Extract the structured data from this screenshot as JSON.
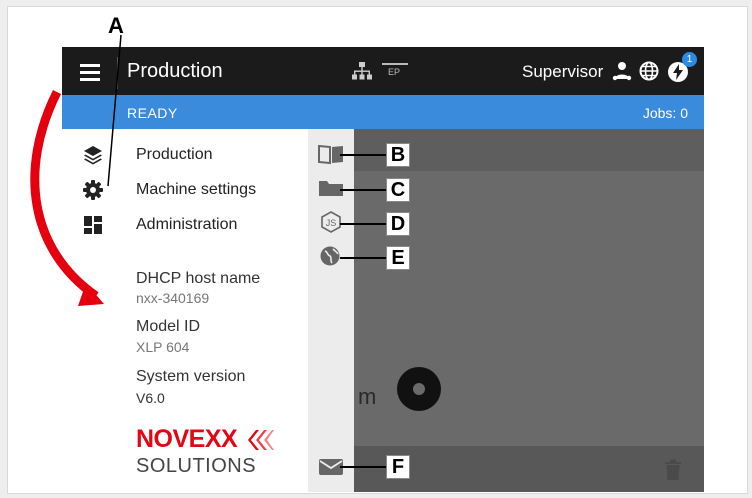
{
  "titlebar": {
    "title": "Production",
    "ep_label": "EP",
    "user_role": "Supervisor",
    "notification_count": "1",
    "icons": [
      "menu-icon",
      "network-icon",
      "ep-icon",
      "supervisor-icon",
      "globe-icon",
      "bolt-icon"
    ]
  },
  "statusbar": {
    "status": "READY",
    "jobs": "Jobs: 0",
    "color": "#3b8bdc"
  },
  "drawer": {
    "menu": [
      {
        "label": "Production",
        "icon": "layers-icon"
      },
      {
        "label": "Machine settings",
        "icon": "gear-icon"
      },
      {
        "label": "Administration",
        "icon": "dashboard-icon"
      }
    ],
    "info": [
      {
        "label": "DHCP host name",
        "value": "nxx-340169"
      },
      {
        "label": "Model ID",
        "value": "XLP 604"
      },
      {
        "label": "System version",
        "value": "V6.0"
      }
    ],
    "logo": {
      "line1": "NOVEXX",
      "line2": "SOLUTIONS",
      "color": "#e30613"
    }
  },
  "rail": {
    "icons": [
      "manual-icon",
      "folder-icon",
      "nodejs-icon",
      "web-icon",
      "mail-icon"
    ]
  },
  "content": {
    "partial_text": "m"
  },
  "callouts": {
    "A": "A",
    "B": "B",
    "C": "C",
    "D": "D",
    "E": "E",
    "F": "F"
  }
}
